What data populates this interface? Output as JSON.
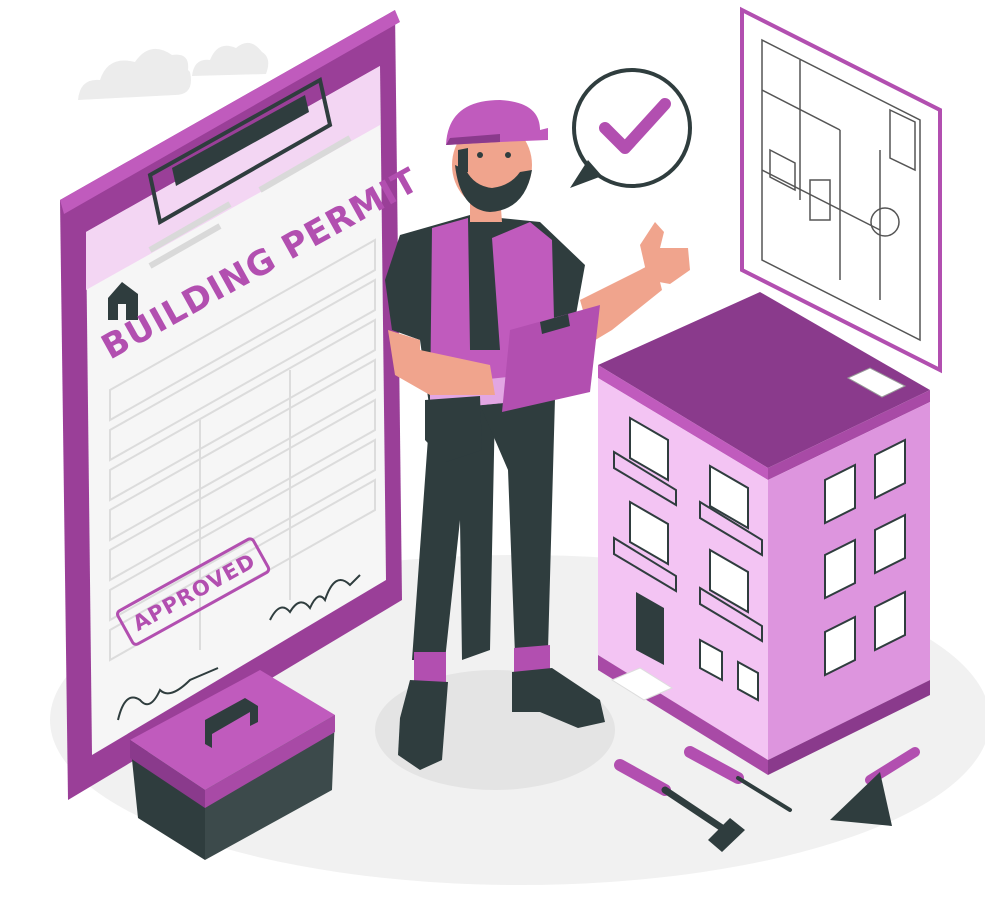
{
  "document": {
    "title": "BUILDING PERMIT",
    "stamp": "APPROVED"
  },
  "colors": {
    "primary": "#b24fb0",
    "dark_purple": "#8a3a8c",
    "light_purple": "#e2a6e3",
    "pale_purple": "#f3d6f3",
    "dark": "#2f3d3e",
    "skin": "#f0a48d",
    "floor": "#efefef",
    "paper": "#f6f6f6"
  },
  "icons": [
    "check-icon",
    "house-icon",
    "clipboard-icon",
    "toolbox-icon",
    "screwdriver-icon",
    "hammer-icon",
    "trowel-icon",
    "cloud-icon",
    "blueprint-icon"
  ]
}
